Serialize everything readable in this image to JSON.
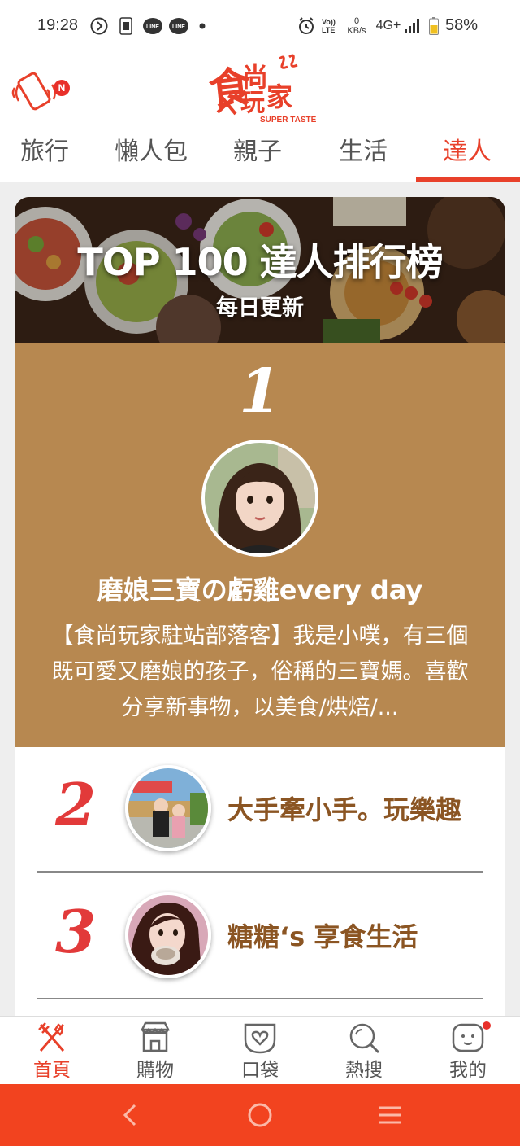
{
  "status_bar": {
    "time": "19:28",
    "battery": "58%",
    "network": "4G+",
    "speed_value": "0",
    "speed_unit": "KB/s",
    "volte": "Vo)) LTE"
  },
  "header": {
    "logo_text": "食尚玩家",
    "logo_sub": "SUPER TASTE",
    "notification_badge": "N"
  },
  "tabs": [
    {
      "label": "旅行"
    },
    {
      "label": "懶人包"
    },
    {
      "label": "親子"
    },
    {
      "label": "生活"
    },
    {
      "label": "達人",
      "active": true
    }
  ],
  "hero": {
    "title": "TOP 100 達人排行榜",
    "subtitle": "每日更新"
  },
  "top_blogger": {
    "rank": "1",
    "name": "磨娘三寶の虧雞every day",
    "description": "【食尚玩家駐站部落客】我是小噗，有三個既可愛又磨娘的孩子，俗稱的三寶媽。喜歡分享新事物，以美食/烘焙/..."
  },
  "ranking": [
    {
      "rank": "2",
      "name": "大手牽小手。玩樂趣"
    },
    {
      "rank": "3",
      "name": "糖糖‘s 享食生活"
    }
  ],
  "bottom_nav": [
    {
      "label": "首頁",
      "icon": "fork-knife-icon",
      "active": true
    },
    {
      "label": "購物",
      "icon": "store-icon"
    },
    {
      "label": "口袋",
      "icon": "heart-pocket-icon"
    },
    {
      "label": "熱搜",
      "icon": "search-icon"
    },
    {
      "label": "我的",
      "icon": "face-icon"
    }
  ],
  "colors": {
    "accent": "#e8402a",
    "rank1_bg": "#b78850",
    "name_brown": "#8b5523",
    "rank_red": "#e23a3a",
    "system_nav": "#f2431f"
  }
}
